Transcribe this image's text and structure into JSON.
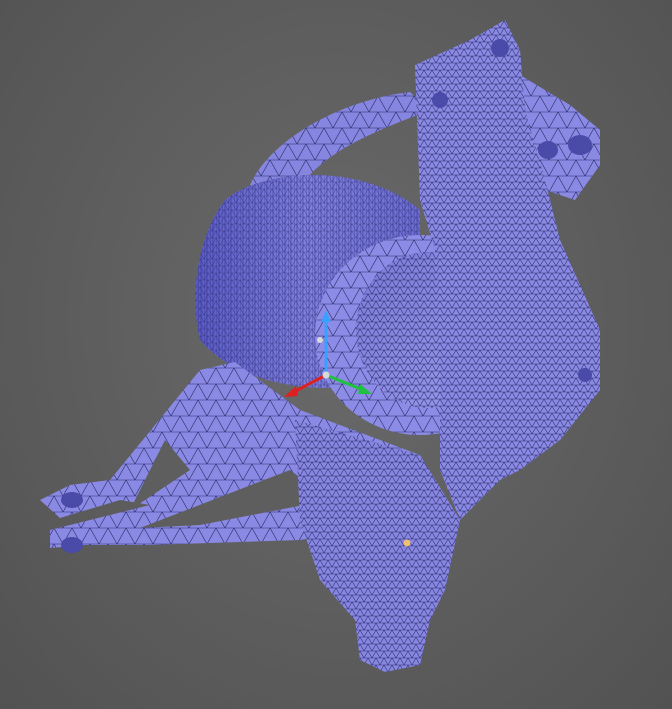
{
  "viewport": {
    "background_color": "#5e5e5e"
  },
  "model": {
    "mesh_fill": "#8c8ce6",
    "mesh_fill_dark": "#6e6ed2",
    "mesh_fill_light": "#a4a4f0",
    "wireframe_color": "#2a2a6a",
    "style": "triangulated-wireframe-over-solid"
  },
  "axis_triad": {
    "x_color": "#e02020",
    "y_color": "#20c040",
    "z_color": "#3aa0ff",
    "origin_color": "#d8d8d8"
  },
  "selection_marker": {
    "color": "#f0c070"
  }
}
